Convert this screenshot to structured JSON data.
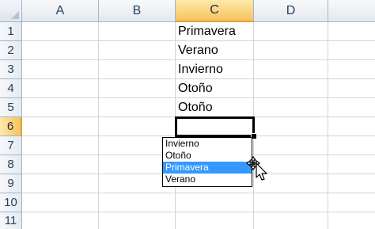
{
  "column_headers": [
    "A",
    "B",
    "C",
    "D"
  ],
  "selected_column": "C",
  "row_headers": [
    "1",
    "2",
    "3",
    "4",
    "5",
    "6",
    "7",
    "8",
    "9",
    "10",
    "11"
  ],
  "selected_row": "6",
  "cells": {
    "C1": "Primavera",
    "C2": "Verano",
    "C3": "Invierno",
    "C4": "Otoño",
    "C5": "Otoño",
    "C6": ""
  },
  "active_cell": "C6",
  "pick_list": {
    "items": [
      "Invierno",
      "Otoño",
      "Primavera",
      "Verano"
    ],
    "highlighted": "Primavera"
  },
  "colors": {
    "selection_highlight": "#3399ff",
    "header_selected": "#f7c35f",
    "gridline": "#d4d4d4",
    "header_border": "#9eb6ce"
  },
  "cursor_icon": "move-arrow-cursor-icon"
}
